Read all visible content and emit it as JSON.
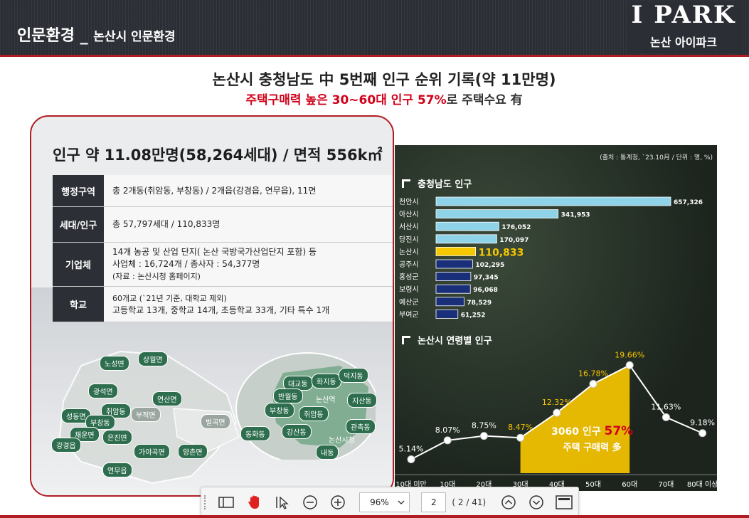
{
  "header": {
    "title": "인문환경 _",
    "subtitle": "논산시 인문환경",
    "brand_logo": "I PARK",
    "brand_name": "논산 아이파크"
  },
  "headline": {
    "main": "논산시 충청남도 中 5번째 인구 순위 기록(약 11만명)",
    "sub_red": "주택구매력 높은 30~60대 인구 57%",
    "sub_rest": "로 주택수요 有"
  },
  "card": {
    "title": "인구 약 11.08만명(58,264세대) / 면적 556k㎡",
    "rows": [
      {
        "key": "행정구역",
        "lines": [
          "총 2개동(취암동, 부창동) / 2개읍(강경읍, 연무읍), 11면"
        ]
      },
      {
        "key": "세대/인구",
        "lines": [
          "총 57,797세대 / 110,833명"
        ]
      },
      {
        "key": "기업체",
        "lines": [
          "14개 농공 및 산업 단지( 논산 국방국가산업단지 포함) 등",
          "사업체 : 16,724개 / 종사자 : 54,377명",
          "(자료 : 논산시청 홈페이지)"
        ]
      },
      {
        "key": "학교",
        "lines": [
          "60개교 (`21년 기준, 대학교 제외)",
          "고등학교 13개, 중학교 14개, 초등학교 33개, 기타 특수 1개"
        ]
      }
    ],
    "map_left_labels": [
      "노성면",
      "상월면",
      "광석면",
      "연산면",
      "취암동",
      "부적면",
      "성동면",
      "부창동",
      "채운면",
      "은진면",
      "벌곡면",
      "강경읍",
      "가야곡면",
      "양촌면",
      "연무읍"
    ],
    "map_right_labels": [
      "대교동",
      "화지동",
      "덕지동",
      "반월동",
      "논산역",
      "지산동",
      "부창동",
      "취암동",
      "관촉동",
      "동화동",
      "강산동",
      "논산시청",
      "내동"
    ]
  },
  "chart_panel": {
    "source": "(출처 : 통계청, `23.10月 / 단위 : 명, %)",
    "bar_title": "충청남도 인구",
    "line_title": "논산시 연령별 인구",
    "callout_line1": "3060 인구 ",
    "callout_pct": "57%",
    "callout_line2": "주택 구매력 多"
  },
  "chart_data": [
    {
      "type": "bar",
      "title": "충청남도 인구",
      "categories": [
        "천안시",
        "아산시",
        "서산시",
        "당진시",
        "논산시",
        "공주시",
        "홍성군",
        "보령시",
        "예산군",
        "부여군"
      ],
      "values": [
        657326,
        341953,
        176052,
        170097,
        110833,
        102295,
        97345,
        96068,
        78529,
        61252
      ],
      "value_labels": [
        "657,326",
        "341,953",
        "176,052",
        "170,097",
        "110,833",
        "102,295",
        "97,345",
        "96,068",
        "78,529",
        "61,252"
      ],
      "highlight": "논산시",
      "colors": {
        "top": "#8fd3e8",
        "highlight": "#f6c800",
        "rest": "#1a2f7a"
      }
    },
    {
      "type": "line",
      "title": "논산시 연령별 인구",
      "categories": [
        "10대 미만",
        "10대",
        "20대",
        "30대",
        "40대",
        "50대",
        "60대",
        "70대",
        "80대 이상"
      ],
      "values": [
        5.14,
        8.07,
        8.75,
        8.47,
        12.32,
        16.78,
        19.66,
        11.63,
        9.18
      ],
      "value_labels": [
        "5.14%",
        "8.07%",
        "8.75%",
        "8.47%",
        "12.32%",
        "16.78%",
        "19.66%",
        "11.63%",
        "9.18%"
      ],
      "highlight_range": [
        "30대",
        "60대"
      ],
      "colors": {
        "line": "#ffffff",
        "area": "#f6c400",
        "label": "#f6c400"
      }
    }
  ],
  "toolbar": {
    "zoom": "96%",
    "page": "2",
    "page_count": "( 2 / 41)"
  }
}
